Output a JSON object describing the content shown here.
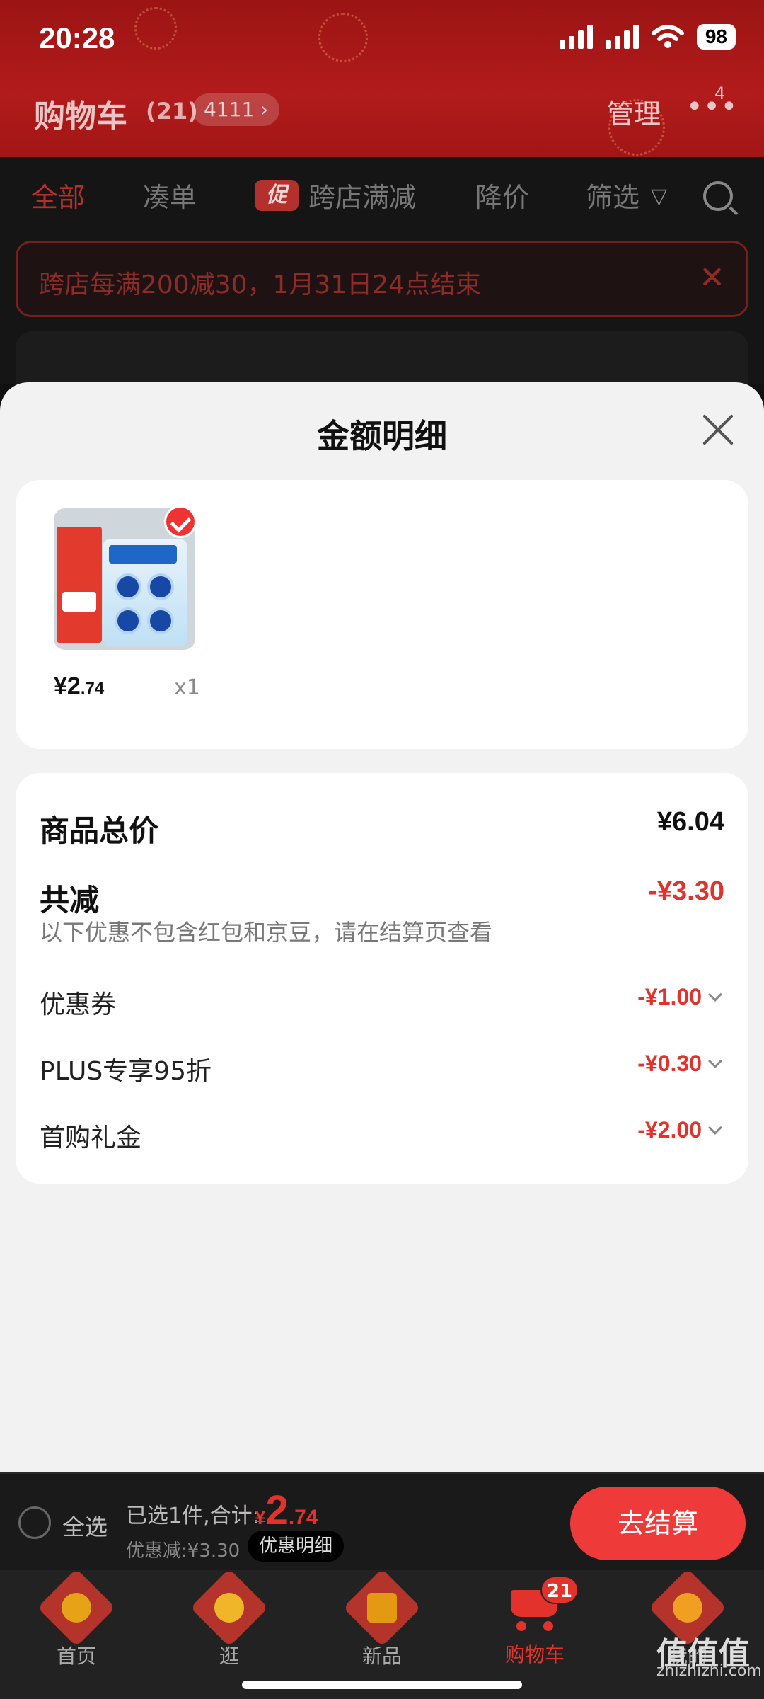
{
  "status_bar": {
    "time": "20:28",
    "battery": "98"
  },
  "header": {
    "title": "购物车",
    "count": "(21)",
    "address_pill": "4111 ›",
    "manage": "管理",
    "more_badge": "4"
  },
  "filter_tabs": {
    "all": "全部",
    "bundle": "凑单",
    "promo_badge": "促",
    "cross_store": "跨店满减",
    "price_drop": "降价",
    "filter": "筛选"
  },
  "notice": {
    "text": "跨店每满200减30，1月31日24点结束"
  },
  "sheet": {
    "title": "金额明细",
    "product": {
      "price_int": "¥2",
      "price_dec": ".74",
      "quantity": "x1"
    },
    "summary": {
      "total_label": "商品总价",
      "total_value": "¥6.04",
      "reduction_label": "共减",
      "reduction_value": "-¥3.30",
      "note": "以下优惠不包含红包和京豆，请在结算页查看",
      "items": [
        {
          "label": "优惠券",
          "value": "-¥1.00"
        },
        {
          "label": "PLUS专享95折",
          "value": "-¥0.30"
        },
        {
          "label": "首购礼金",
          "value": "-¥2.00"
        }
      ]
    }
  },
  "checkout": {
    "select_all": "全选",
    "selected_info": "已选1件,合计:",
    "total_currency": "¥",
    "total_int": "2",
    "total_dec": ".74",
    "discount_line": "优惠减:¥3.30",
    "detail_button": "优惠明细",
    "checkout_button": "去结算"
  },
  "tabbar": {
    "items": [
      {
        "label": "首页"
      },
      {
        "label": "逛"
      },
      {
        "label": "新品"
      },
      {
        "label": "购物车"
      },
      {
        "label": "我的"
      }
    ],
    "cart_badge": "21"
  },
  "watermark": {
    "big": "值值值",
    "small": "zhizhizhi.com"
  },
  "colors": {
    "accent": "#e3322b",
    "header_red": "#b21b1b",
    "sheet_bg": "#f2f2f2"
  }
}
